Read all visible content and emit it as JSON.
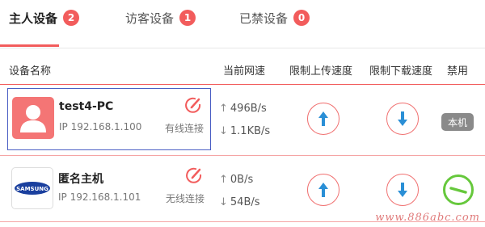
{
  "tabs": [
    {
      "label": "主人设备",
      "count": "2",
      "active": true
    },
    {
      "label": "访客设备",
      "count": "1",
      "active": false
    },
    {
      "label": "已禁设备",
      "count": "0",
      "active": false
    }
  ],
  "table": {
    "headers": {
      "device_name": "设备名称",
      "current_speed": "当前网速",
      "limit_upload": "限制上传速度",
      "limit_download": "限制下载速度",
      "ban": "禁用"
    },
    "rows": [
      {
        "name": "test4-PC",
        "ip": "IP 192.168.1.100",
        "connection": "有线连接",
        "upload_speed": "496B/s",
        "download_speed": "1.1KB/s",
        "self_label": "本机",
        "avatar_icon": "user-avatar-icon"
      },
      {
        "name": "匿名主机",
        "ip": "IP 192.168.1.101",
        "connection": "无线连接",
        "upload_speed": "0B/s",
        "download_speed": "54B/s",
        "avatar_icon": "samsung-logo-icon",
        "logo_text": "SAMSUNG"
      }
    ]
  },
  "watermark": "www.886abc.com",
  "colors": {
    "accent": "#f25c5c",
    "selection_border": "#4a5ec4",
    "arrow_up": "#2a8fd6",
    "arrow_down": "#2a8fd6",
    "ban_green": "#66c83c"
  }
}
